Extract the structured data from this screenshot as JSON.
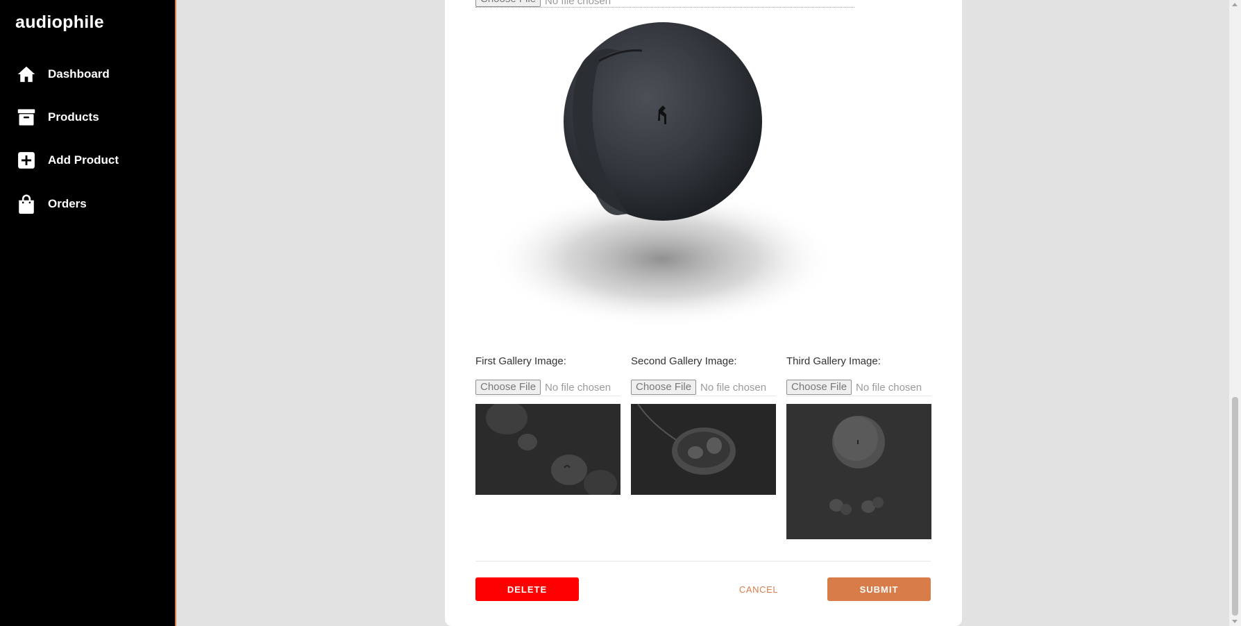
{
  "brand": {
    "logo": "audiophile",
    "accent": "#d87d4a"
  },
  "sidebar": {
    "items": [
      {
        "label": "Dashboard",
        "icon": "home-icon"
      },
      {
        "label": "Products",
        "icon": "archive-box-icon"
      },
      {
        "label": "Add Product",
        "icon": "plus-square-icon"
      },
      {
        "label": "Orders",
        "icon": "shopping-bag-icon"
      }
    ]
  },
  "form": {
    "main_image": {
      "choose_label": "Choose File",
      "no_file": "No file chosen"
    },
    "gallery": [
      {
        "label": "First Gallery Image:",
        "choose_label": "Choose File",
        "no_file": "No file chosen"
      },
      {
        "label": "Second Gallery Image:",
        "choose_label": "Choose File",
        "no_file": "No file chosen"
      },
      {
        "label": "Third Gallery Image:",
        "choose_label": "Choose File",
        "no_file": "No file chosen"
      }
    ],
    "buttons": {
      "delete": "DELETE",
      "cancel": "CANCEL",
      "submit": "SUBMIT"
    }
  },
  "colors": {
    "delete": "#ff0000",
    "submit": "#d87d4a",
    "sidebar_bg": "#000000",
    "page_bg": "#e2e2e2"
  }
}
